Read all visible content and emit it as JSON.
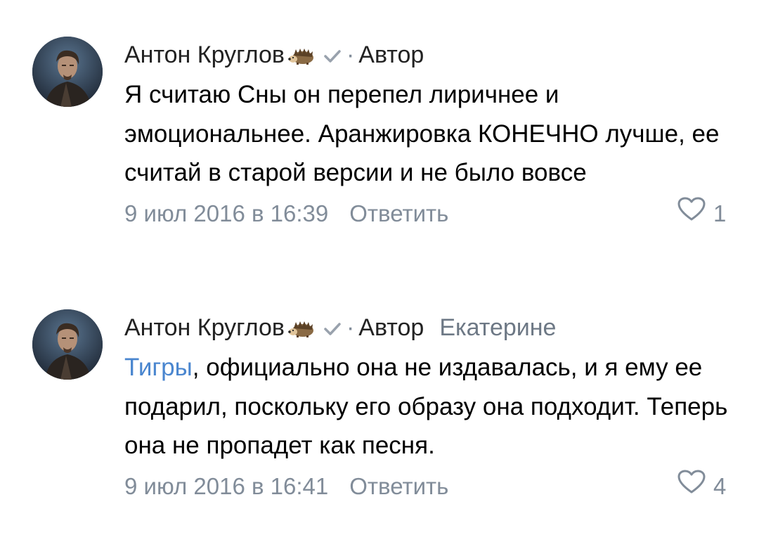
{
  "comments": [
    {
      "author": "Антон Круглов",
      "separator": "·",
      "role": "Автор",
      "reply_to": "",
      "text": "Я считаю Сны он перепел лиричнее и эмоциональнее. Аранжировка КОНЕЧНО лучше, ее считай в старой версии и не было вовсе",
      "date": "9 июл 2016 в 16:39",
      "reply_label": "Ответить",
      "likes": "1"
    },
    {
      "author": "Антон Круглов",
      "separator": "·",
      "role": "Автор",
      "reply_to": "Екатерине",
      "mention": "Тигры",
      "text": ", официально она не издавалась, и я ему ее подарил, поскольку его образу она подходит. Теперь она не пропадет как песня.",
      "date": "9 июл 2016 в 16:41",
      "reply_label": "Ответить",
      "likes": "4"
    }
  ],
  "icons": {
    "author_badge": "hedgehog-icon",
    "verified": "checkmark-icon",
    "like": "heart-outline-icon"
  },
  "colors": {
    "text": "#000000",
    "secondary": "#818c99",
    "mention": "#4a86cf"
  }
}
